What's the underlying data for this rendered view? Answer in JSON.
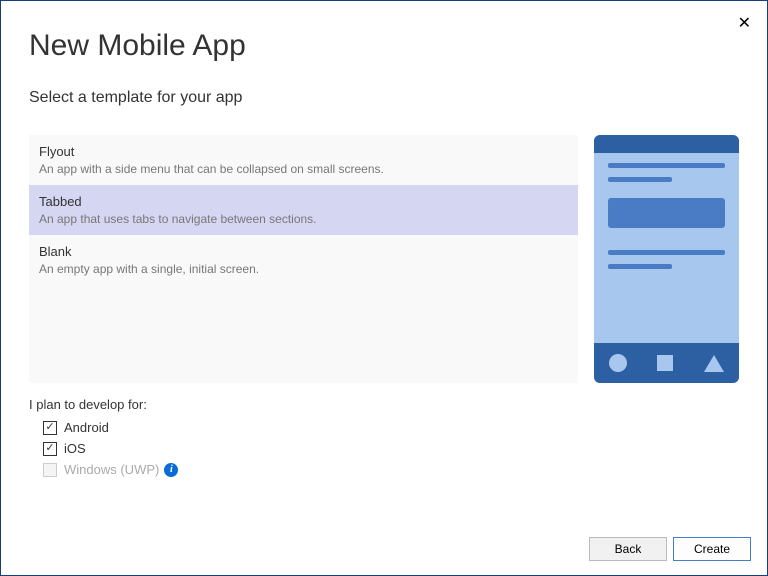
{
  "window": {
    "title": "New Mobile App",
    "subtitle": "Select a template for your app"
  },
  "templates": [
    {
      "title": "Flyout",
      "desc": "An app with a side menu that can be collapsed on small screens.",
      "selected": false
    },
    {
      "title": "Tabbed",
      "desc": "An app that uses tabs to navigate between sections.",
      "selected": true
    },
    {
      "title": "Blank",
      "desc": "An empty app with a single, initial screen.",
      "selected": false
    }
  ],
  "plan": {
    "label": "I plan to develop for:",
    "options": [
      {
        "label": "Android",
        "checked": true,
        "disabled": false
      },
      {
        "label": "iOS",
        "checked": true,
        "disabled": false
      },
      {
        "label": "Windows (UWP)",
        "checked": false,
        "disabled": true,
        "info": true
      }
    ]
  },
  "buttons": {
    "back": "Back",
    "create": "Create"
  }
}
